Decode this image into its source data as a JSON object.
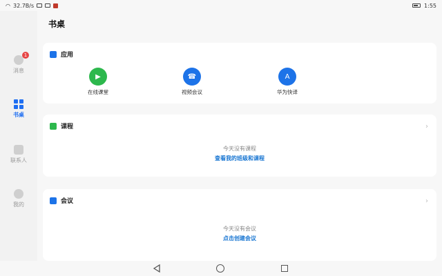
{
  "status": {
    "speed": "32.7B/s",
    "time": "1:55"
  },
  "sidebar": {
    "items": [
      {
        "label": "消息",
        "badge": "1"
      },
      {
        "label": "书桌"
      },
      {
        "label": "联系人"
      },
      {
        "label": "我的"
      }
    ]
  },
  "page": {
    "title": "书桌"
  },
  "apps_card": {
    "title": "应用",
    "apps": [
      {
        "label": "在线课堂",
        "color": "#2db84d"
      },
      {
        "label": "视频会议",
        "color": "#1d73e8"
      },
      {
        "label": "华为快译",
        "color": "#1d73e8"
      }
    ]
  },
  "courses_card": {
    "title": "课程",
    "empty": "今天没有课程",
    "link": "查看我的班级和课程"
  },
  "meetings_card": {
    "title": "会议",
    "empty": "今天没有会议",
    "link": "点击创建会议"
  },
  "colors": {
    "accent": "#1f6ff2",
    "link": "#1976d2",
    "badge": "#e64545"
  }
}
